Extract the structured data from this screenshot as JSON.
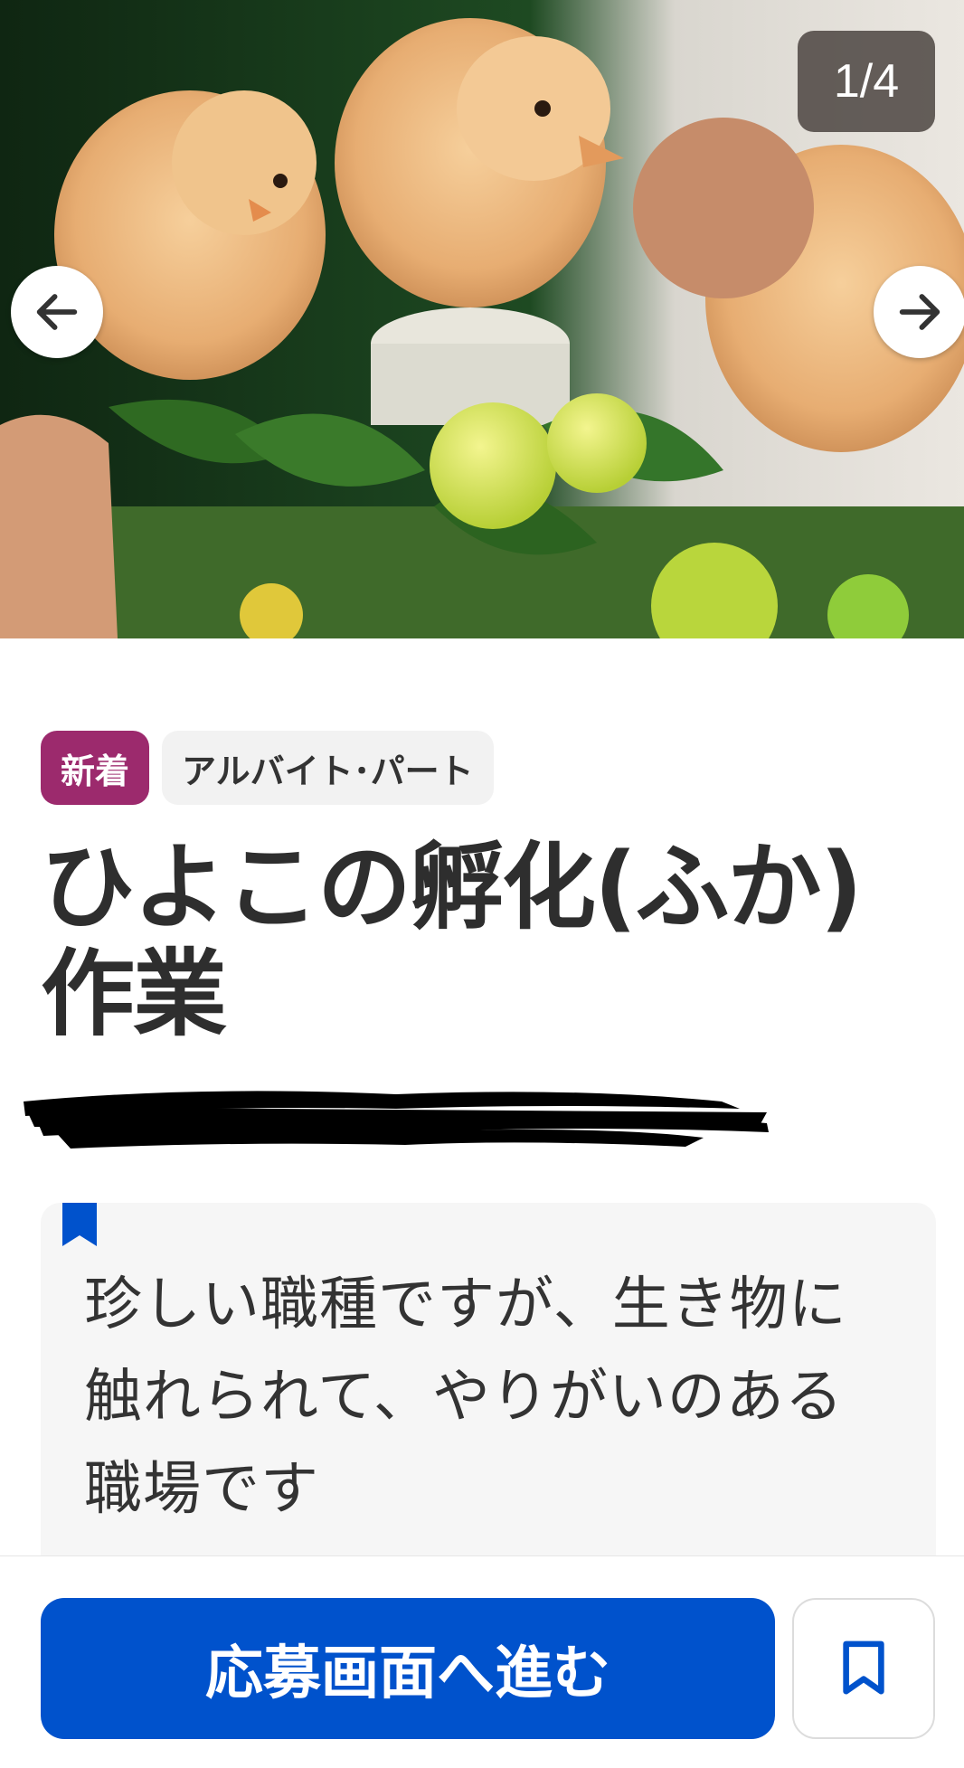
{
  "carousel": {
    "current": "1",
    "separator": "/",
    "total": "4",
    "prev_icon": "arrow-left-icon",
    "next_icon": "arrow-right-icon"
  },
  "tags": {
    "new_label": "新着",
    "type_label": "アルバイト･パート"
  },
  "job": {
    "title_line1": "ひよこの孵化(ふか)",
    "title_line2": "作業"
  },
  "catch": {
    "icon": "bookmark-icon",
    "line1": "珍しい職種ですが、生き物に",
    "line2": "触れられて、やりがいのある",
    "line3": "職場です"
  },
  "actions": {
    "apply_label": "応募画面へ進む",
    "save_icon": "bookmark-outline-icon"
  },
  "colors": {
    "new_tag": "#9c2a6d",
    "primary": "#0052cc",
    "text": "#333333"
  }
}
